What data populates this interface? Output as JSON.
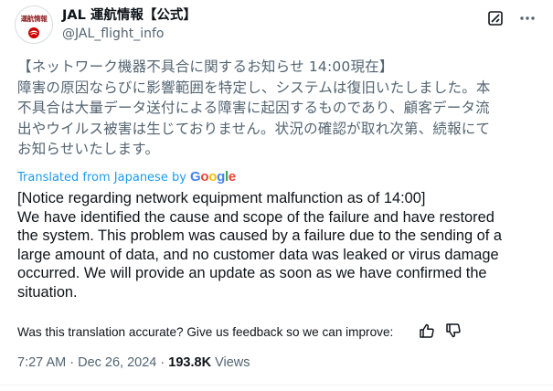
{
  "author": {
    "display_name": "JAL 運航情報【公式】",
    "handle": "@JAL_flight_info",
    "avatar_text": "運航情報"
  },
  "tweet": {
    "original_lines": [
      "【ネットワーク機器不具合に関するお知らせ 14:00現在】",
      "障害の原因ならびに影響範囲を特定し、システムは復旧いたしました。本",
      "不具合は大量データ送付による障害に起因するものであり、顧客データ流",
      "出やウイルス被害は生じておりません。状況の確認が取れ次第、続報にて",
      "お知らせいたします。"
    ],
    "translated_by_label": "Translated from Japanese by",
    "translation_provider": "Google",
    "translation_lines": [
      "[Notice regarding network equipment malfunction as of 14:00]",
      "We have identified the cause and scope of the failure and have restored",
      "the system. This problem was caused by a failure due to the sending of a",
      "large amount of data, and no customer data was leaked or virus damage",
      "occurred. We will provide an update as soon as we have confirmed the",
      "situation."
    ],
    "feedback_prompt": "Was this translation accurate? Give us feedback so we can improve:",
    "time": "7:27 AM",
    "date": "Dec 26, 2024",
    "separator": "·",
    "views_count": "193.8K",
    "views_label": "Views"
  },
  "colors": {
    "text": "#0f1419",
    "secondary": "#536471",
    "link": "#1d9bf0"
  },
  "icons": [
    "grok-icon",
    "more-icon",
    "thumbs-up-icon",
    "thumbs-down-icon",
    "jal-crane-logo-icon"
  ]
}
